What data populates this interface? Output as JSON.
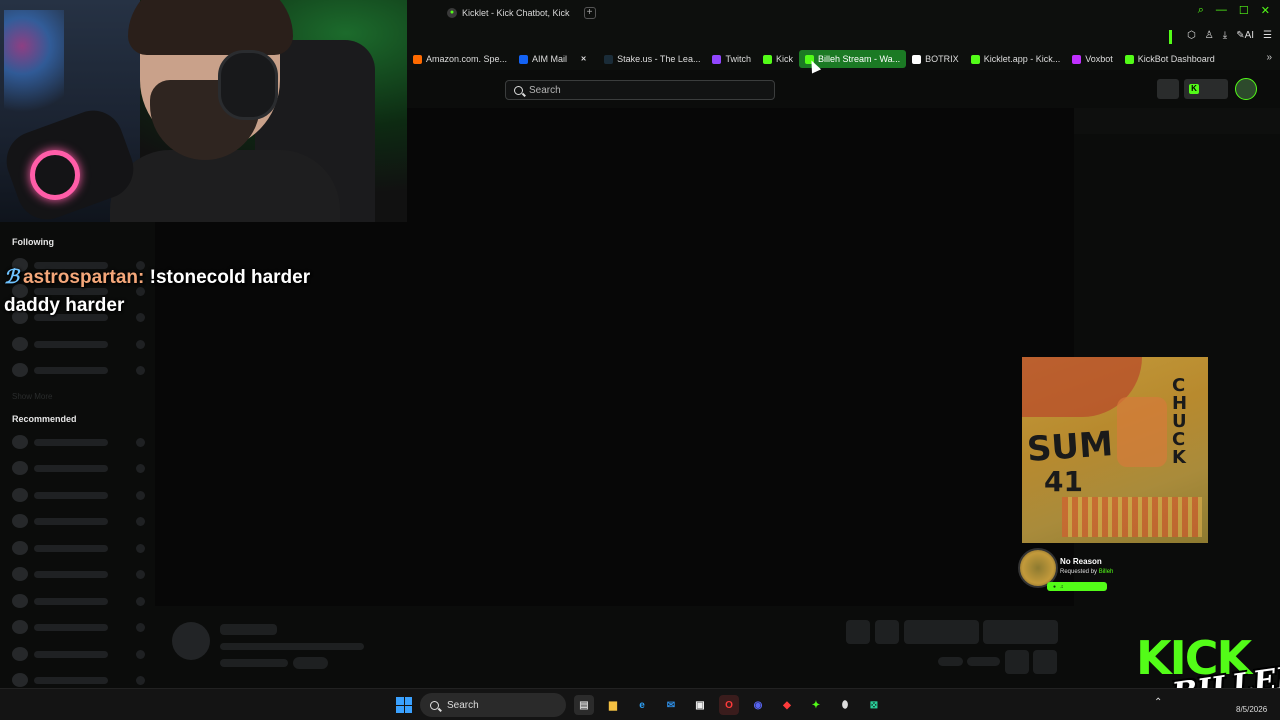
{
  "browser": {
    "tab_title": "Kicklet - Kick Chatbot, Kick",
    "new_tab": "+",
    "toolbar_ai": "AI"
  },
  "bookmarks": [
    {
      "label": "Amazon.com. Spe...",
      "icon": "amazon-icon",
      "color": "#ff6a00"
    },
    {
      "label": "AIM Mail",
      "icon": "aim-icon",
      "color": "#1463f5"
    },
    {
      "label": "",
      "icon": "x-icon",
      "color": "#000000"
    },
    {
      "label": "Stake.us - The Lea...",
      "icon": "stake-icon",
      "color": "#1a2c38"
    },
    {
      "label": "Twitch",
      "icon": "twitch-icon",
      "color": "#9146ff"
    },
    {
      "label": "Kick",
      "icon": "kick-icon",
      "color": "#53fc18"
    },
    {
      "label": "Billeh Stream - Wa...",
      "icon": "kick-icon",
      "color": "#53fc18",
      "active": true
    },
    {
      "label": "BOTRIX",
      "icon": "botrix-icon",
      "color": "#ffffff"
    },
    {
      "label": "Kicklet.app - Kick...",
      "icon": "kicklet-icon",
      "color": "#53fc18"
    },
    {
      "label": "Voxbot",
      "icon": "voxbot-icon",
      "color": "#c030ff"
    },
    {
      "label": "KickBot Dashboard",
      "icon": "kickbot-icon",
      "color": "#53fc18"
    }
  ],
  "kick_header": {
    "search_placeholder": "Search"
  },
  "sidebar": {
    "following_label": "Following",
    "show_more_label": "Show More",
    "recommended_label": "Recommended"
  },
  "chat_message": {
    "badge": "ℬ",
    "username": "astrospartan:",
    "text": "!stonecold harder daddy harder"
  },
  "now_playing": {
    "title": "No Reason",
    "requested_prefix": "Requested by",
    "requested_by": "Billeh",
    "album_text_1": "SUM",
    "album_text_2": "41",
    "album_text_3": "CHUCK"
  },
  "overlay_logo": {
    "kick": "KICK",
    "name": "BILLEH"
  },
  "taskbar": {
    "search_label": "Search",
    "clock": "8/5/2026"
  },
  "colors": {
    "kick_green": "#53fc18",
    "active_bookmark": "#1b7a24",
    "chat_username": "#f4a77a"
  }
}
